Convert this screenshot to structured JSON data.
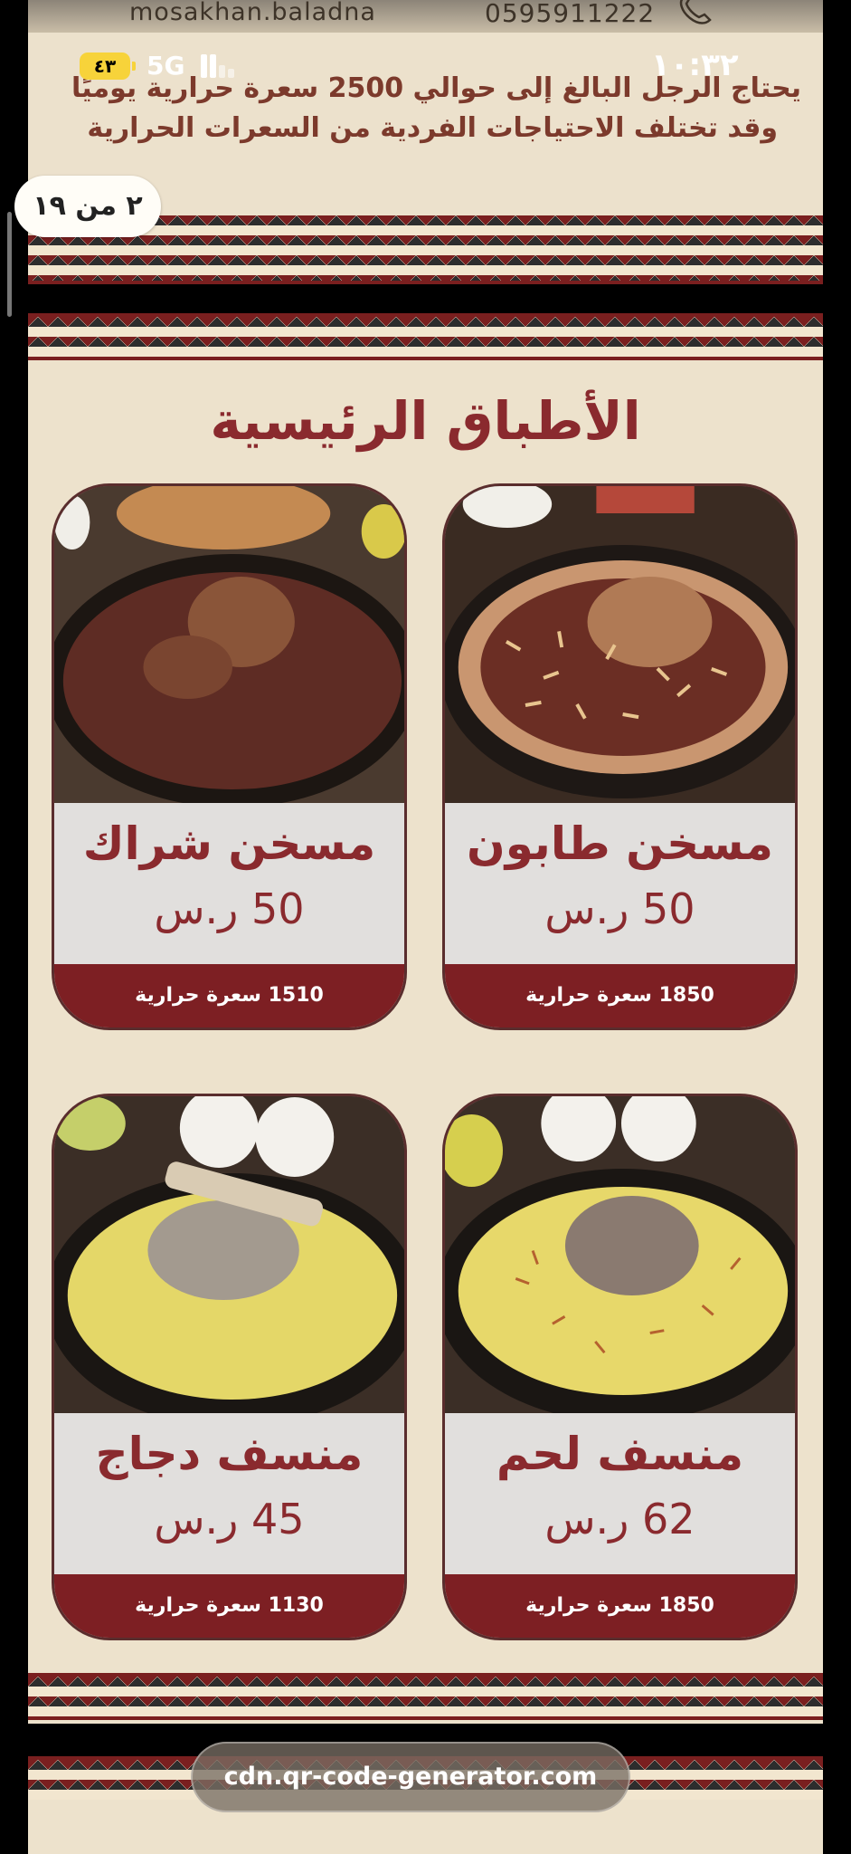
{
  "top_strip": {
    "contact_handle": "mosakhan.baladna",
    "contact_phone": "0595911222",
    "intro_line_1": "يحتاج الرجل البالغ إلى حوالي 2500 سعرة حرارية يوميًا",
    "intro_line_2": "وقد تختلف الاحتياجات الفردية من السعرات الحرارية",
    "page_indicator": "٢ من ١٩"
  },
  "status_bar": {
    "time": "١٠:٣٢",
    "network": "5G",
    "battery": "٤٣"
  },
  "menu": {
    "title": "الأطباق الرئيسية",
    "items": [
      {
        "name": "مسخن طابون",
        "price": "50 ر.س",
        "calories": "1850 سعرة حرارية"
      },
      {
        "name": "مسخن شراك",
        "price": "50 ر.س",
        "calories": "1510 سعرة حرارية"
      },
      {
        "name": "منسف لحم",
        "price": "62 ر.س",
        "calories": "1850 سعرة حرارية"
      },
      {
        "name": "منسف دجاج",
        "price": "45 ر.س",
        "calories": "1130 سعرة حرارية"
      }
    ]
  },
  "browser": {
    "url": "cdn.qr-code-generator.com"
  },
  "colors": {
    "brand_maroon": "#7d1f23",
    "title_red": "#8a2a2e",
    "paper": "#ede2cc",
    "battery_yellow": "#f7d33a"
  }
}
